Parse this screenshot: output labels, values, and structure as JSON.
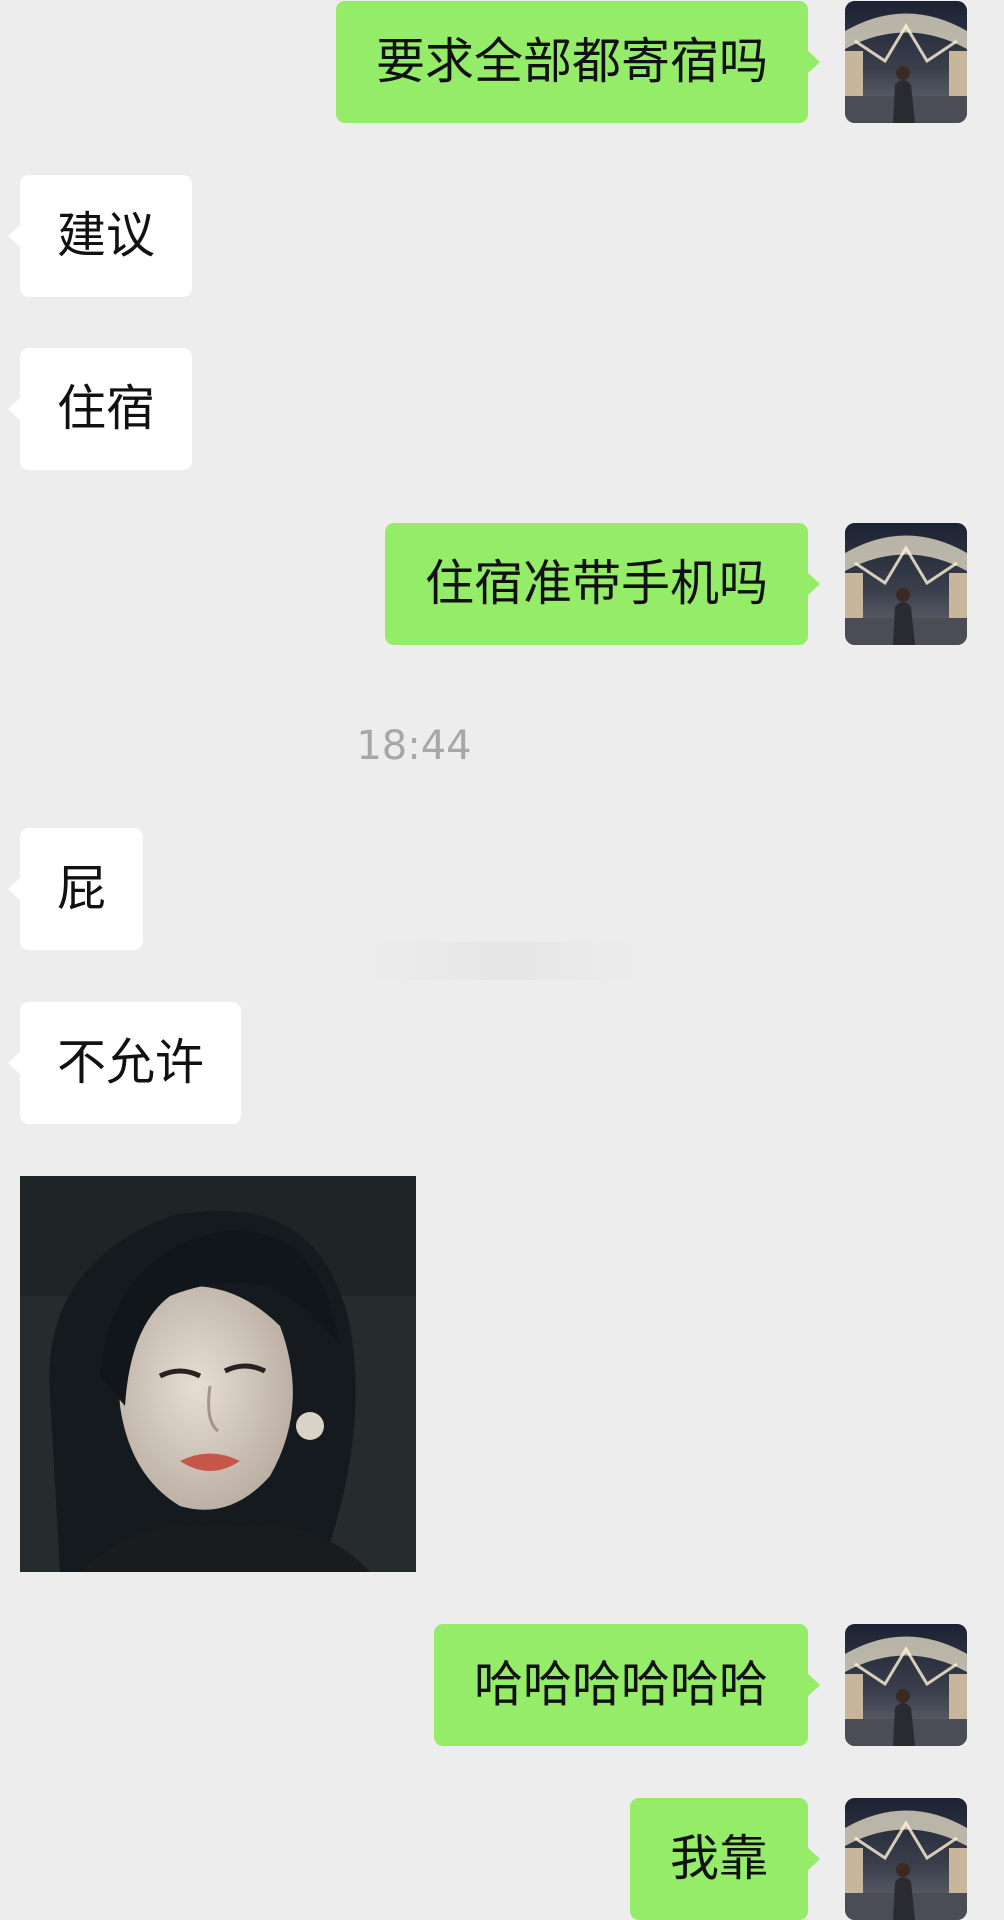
{
  "messages": [
    {
      "direction": "out",
      "text": "要求全部都寄宿吗"
    },
    {
      "direction": "in",
      "text": "建议"
    },
    {
      "direction": "in",
      "text": "住宿"
    },
    {
      "direction": "out",
      "text": "住宿准带手机吗"
    },
    {
      "direction": "in",
      "text": "屁"
    },
    {
      "direction": "in",
      "text": "不允许"
    },
    {
      "direction": "in",
      "type": "sticker",
      "icon": "portrait-sticker"
    },
    {
      "direction": "out",
      "text": "哈哈哈哈哈哈"
    },
    {
      "direction": "out",
      "text": "我靠"
    }
  ],
  "timestamp": "18:44",
  "colors": {
    "background": "#ededed",
    "outgoing_bubble": "#95ec69",
    "incoming_bubble": "#ffffff",
    "timestamp_text": "#a7a7a7"
  },
  "icons": {
    "self_avatar": "avatar-icon"
  }
}
